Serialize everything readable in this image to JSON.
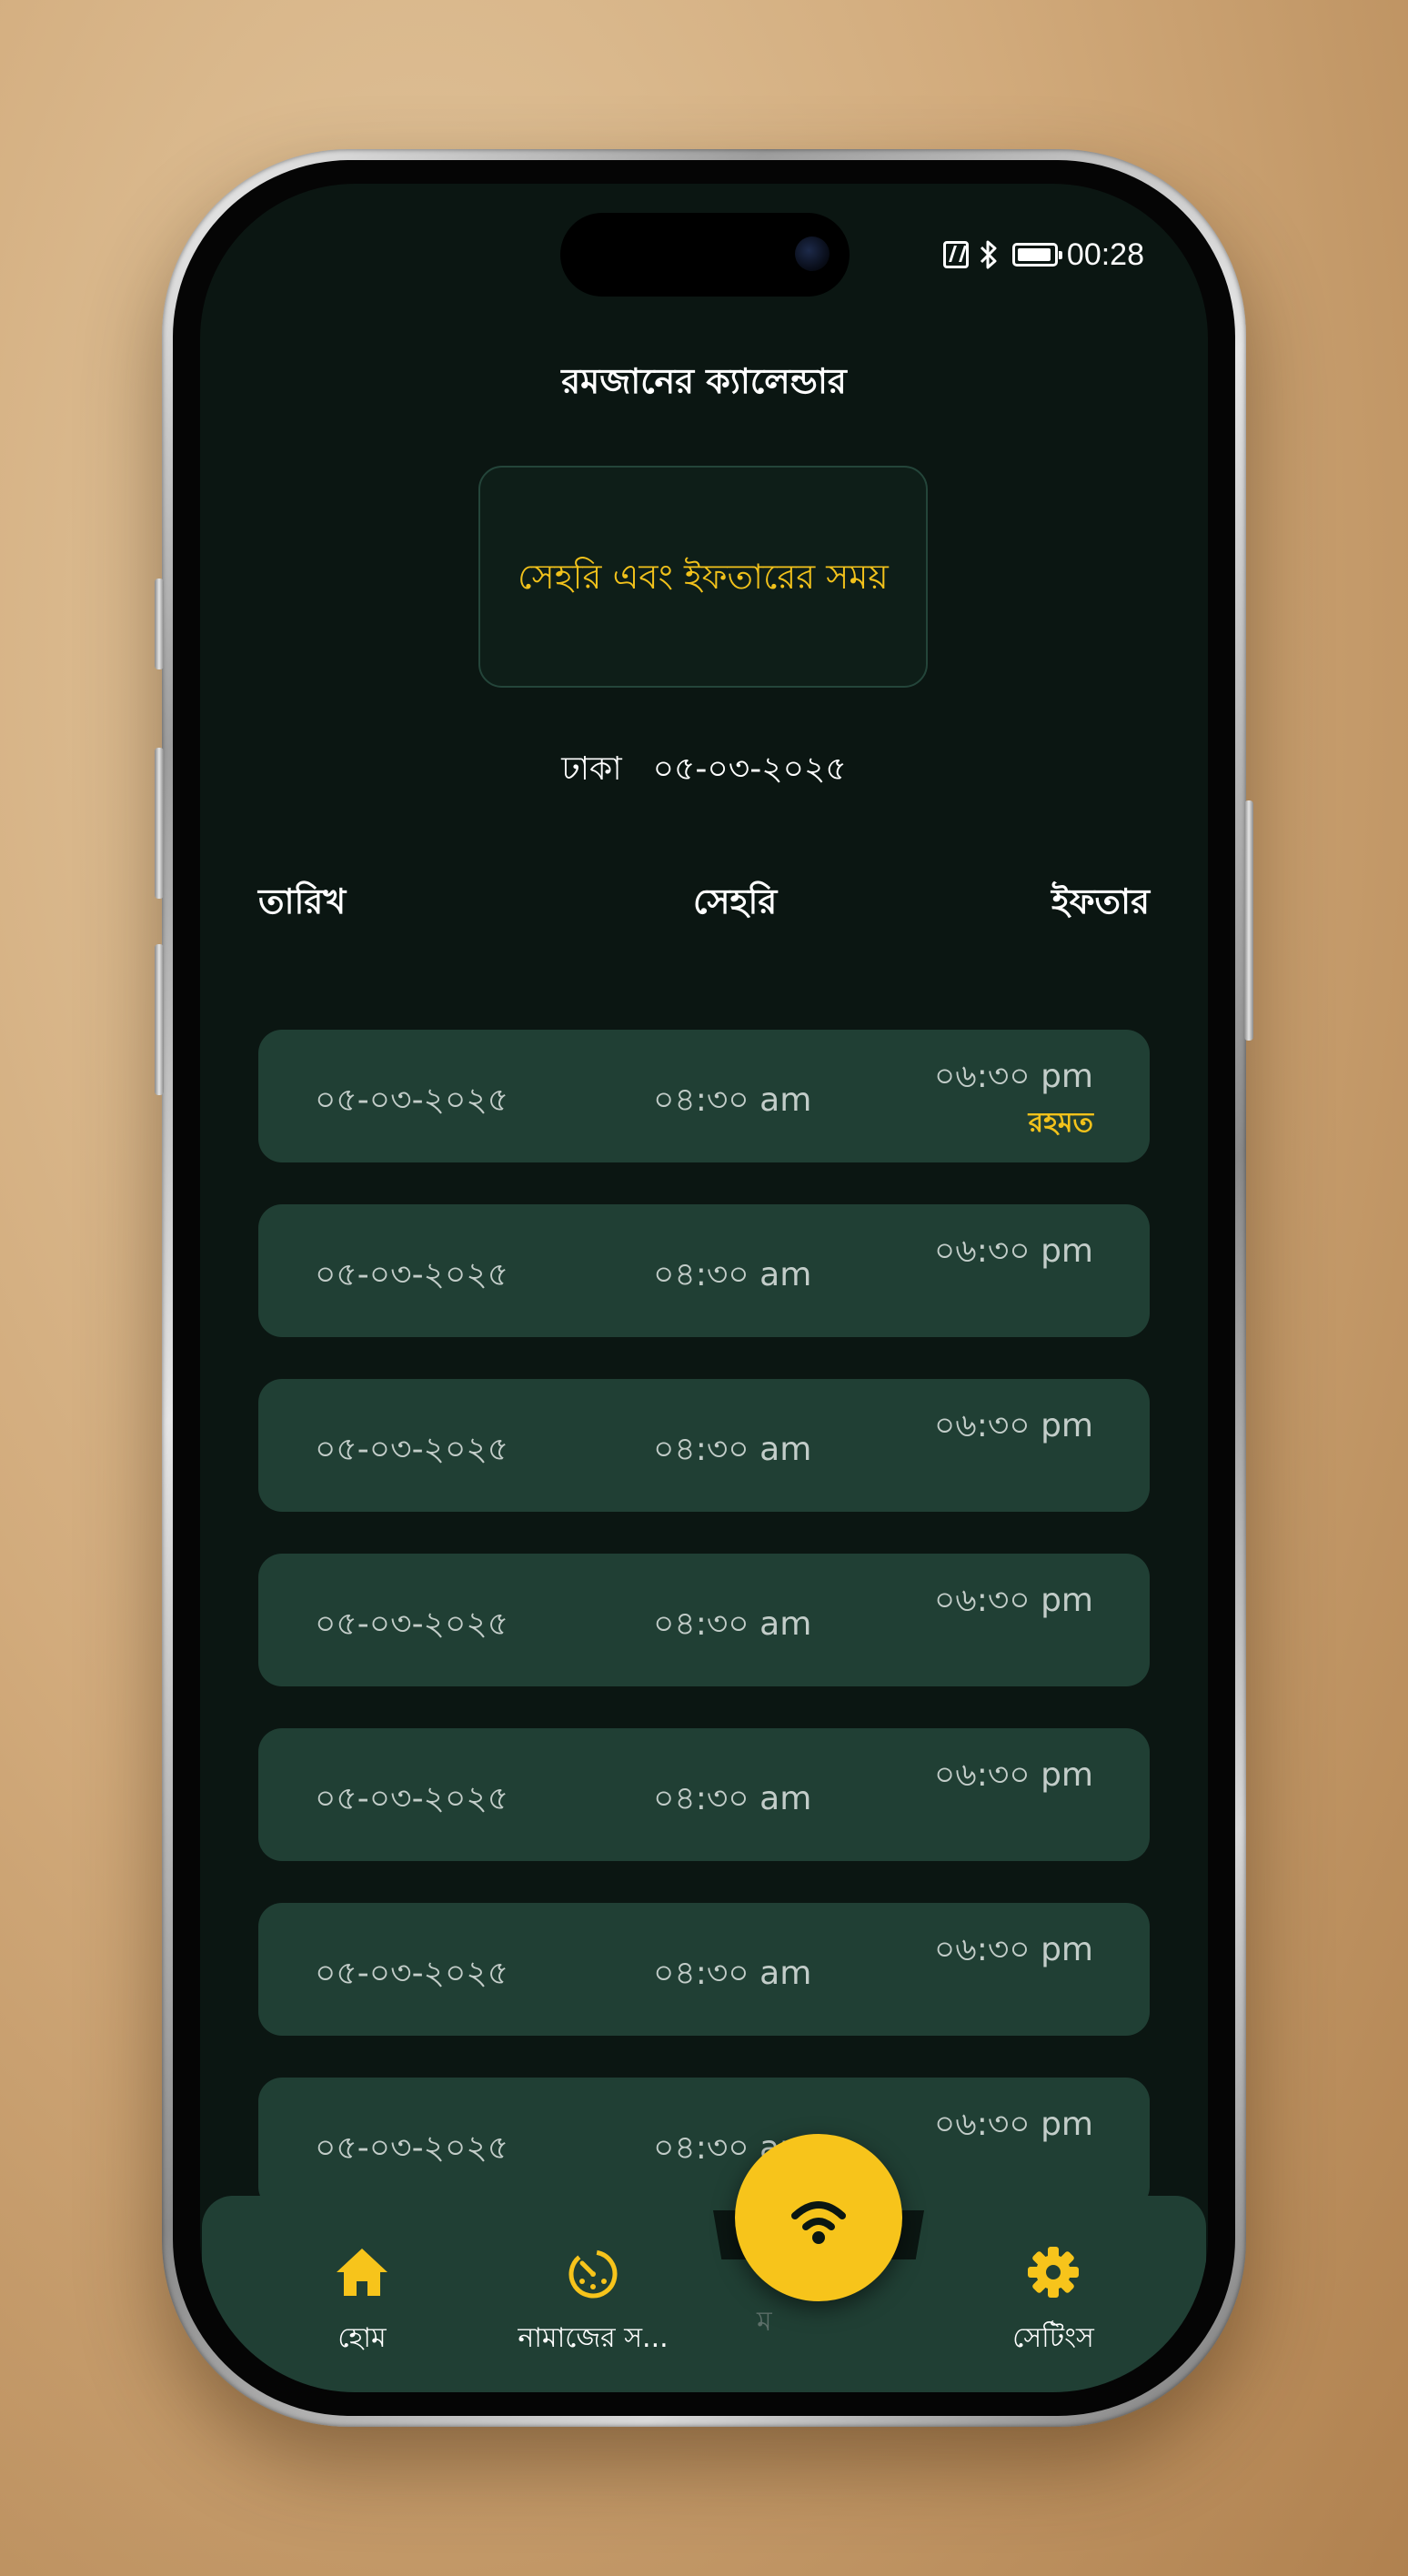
{
  "status_bar": {
    "time": "00:28",
    "icons": [
      "nfc-icon",
      "bluetooth-icon",
      "battery-icon"
    ]
  },
  "header": {
    "title": "রমজানের ক্যালেন্ডার"
  },
  "info_card": {
    "text": "সেহরি এবং ইফতারের সময়"
  },
  "location": {
    "city": "ঢাকা",
    "date": "০৫-০৩-২০২৫"
  },
  "table": {
    "headers": [
      "তারিখ",
      "সেহরি",
      "ইফতার"
    ],
    "rows": [
      {
        "date": "০৫-০৩-২০২৫",
        "sehri": "০৪:৩০ am",
        "iftar": "০৬:৩০ pm",
        "tag": "রহমত"
      },
      {
        "date": "০৫-০৩-২০২৫",
        "sehri": "০৪:৩০ am",
        "iftar": "০৬:৩০ pm"
      },
      {
        "date": "০৫-০৩-২০২৫",
        "sehri": "০৪:৩০ am",
        "iftar": "০৬:৩০ pm"
      },
      {
        "date": "০৫-০৩-২০২৫",
        "sehri": "০৪:৩০ am",
        "iftar": "০৬:৩০ pm"
      },
      {
        "date": "০৫-০৩-২০২৫",
        "sehri": "০৪:৩০ am",
        "iftar": "০৬:৩০ pm"
      },
      {
        "date": "০৫-০৩-২০২৫",
        "sehri": "০৪:৩০ am",
        "iftar": "০৬:৩০ pm"
      },
      {
        "date": "০৫-০৩-২০২৫",
        "sehri": "০৪:৩০ am",
        "iftar": "০৬:৩০ pm"
      }
    ]
  },
  "bottom_nav": {
    "items": [
      {
        "label": "হোম",
        "icon": "home-icon"
      },
      {
        "label": "নামাজের স...",
        "icon": "prayer-timer-icon"
      },
      {
        "label": "সেটিংস",
        "icon": "gear-icon"
      }
    ],
    "hidden_label_fragment": "ম",
    "fab_icon": "ramadan-signal-icon"
  },
  "colors": {
    "background": "#0b1612",
    "row": "#203f34",
    "accent": "#f7c41b",
    "text": "#ffffff"
  }
}
